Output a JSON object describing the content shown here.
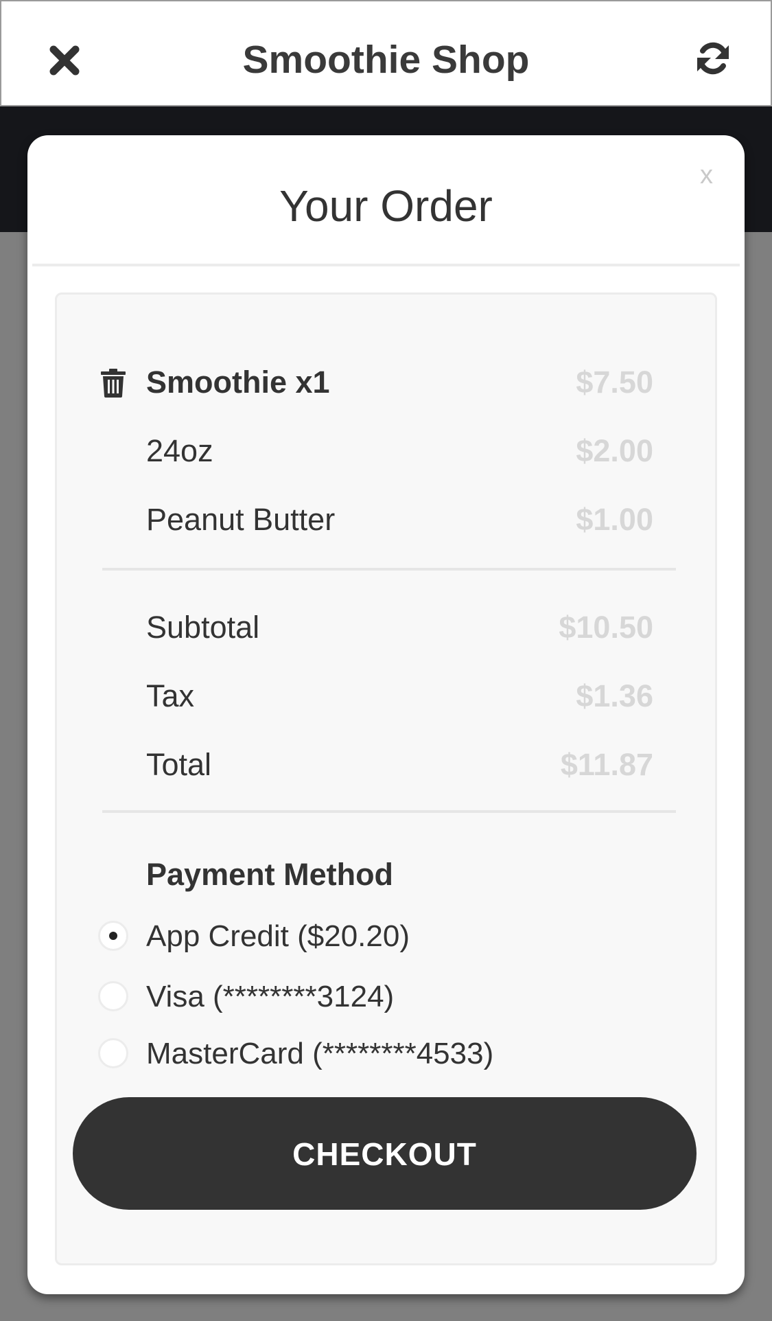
{
  "app": {
    "title": "Smoothie Shop",
    "close_icon": "close-icon",
    "refresh_icon": "refresh-icon"
  },
  "modal": {
    "title": "Your Order",
    "close_label": "x"
  },
  "order": {
    "item": {
      "label": "Smoothie x1",
      "price": "$7.50",
      "icon": "trash-icon"
    },
    "options": [
      {
        "label": "24oz",
        "price": "$2.00"
      },
      {
        "label": "Peanut Butter",
        "price": "$1.00"
      }
    ],
    "totals": [
      {
        "label": "Subtotal",
        "price": "$10.50"
      },
      {
        "label": "Tax",
        "price": "$1.36"
      },
      {
        "label": "Total",
        "price": "$11.87"
      }
    ]
  },
  "payment": {
    "heading": "Payment Method",
    "methods": [
      {
        "label": "App Credit ($20.20)",
        "selected": true
      },
      {
        "label": "Visa (********3124)",
        "selected": false
      },
      {
        "label": "MasterCard (********4533)",
        "selected": false
      }
    ]
  },
  "checkout_label": "CHECKOUT",
  "colors": {
    "overlay": "#7f7f7f",
    "header_band": "#15161a",
    "button": "#333333",
    "price_text": "#d7d7d7"
  }
}
